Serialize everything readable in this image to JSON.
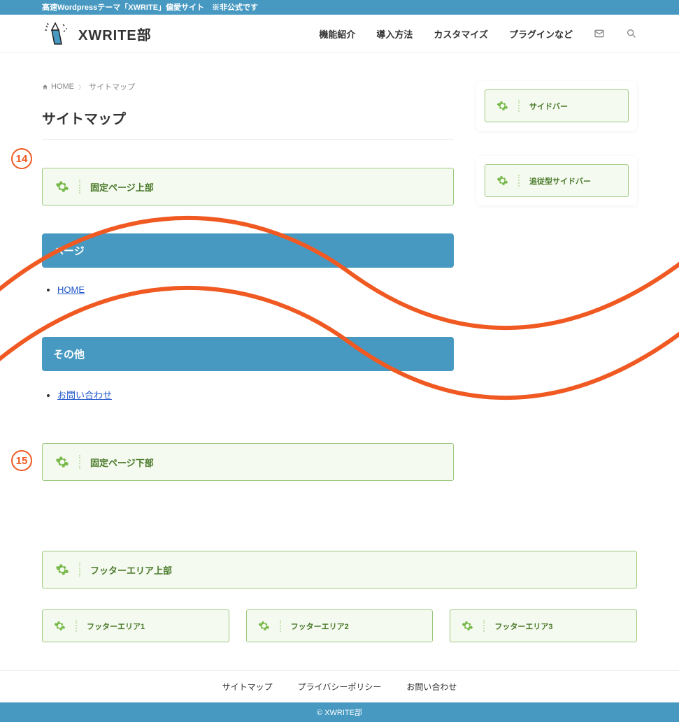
{
  "topbar": {
    "text": "高速Wordpressテーマ「XWRITE」偏愛サイト　※非公式です"
  },
  "logo": {
    "text": "XWRITE部"
  },
  "nav": {
    "items": [
      "機能紹介",
      "導入方法",
      "カスタマイズ",
      "プラグインなど"
    ]
  },
  "breadcrumb": {
    "home": "HOME",
    "current": "サイトマップ"
  },
  "page_title": "サイトマップ",
  "widgets": {
    "page_top": "固定ページ上部",
    "page_bottom": "固定ページ下部",
    "sidebar": "サイドバー",
    "sidebar_sticky": "追従型サイドバー",
    "footer_top": "フッターエリア上部",
    "footer1": "フッターエリア1",
    "footer2": "フッターエリア2",
    "footer3": "フッターエリア3"
  },
  "sections": {
    "pages": {
      "title": "ページ",
      "links": [
        "HOME"
      ]
    },
    "other": {
      "title": "その他",
      "links": [
        "お問い合わせ"
      ]
    }
  },
  "badges": {
    "b14": "14",
    "b15": "15"
  },
  "footer_nav": [
    "サイトマップ",
    "プライバシーポリシー",
    "お問い合わせ"
  ],
  "copyright": "© XWRITE部"
}
